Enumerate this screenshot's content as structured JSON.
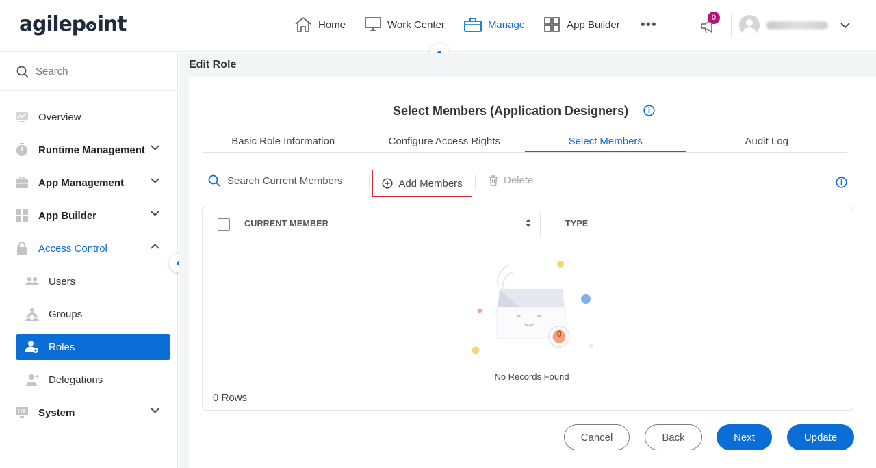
{
  "brand": {
    "logo_text_a": "agile",
    "logo_text_b": "int",
    "logo_letter_p": "p"
  },
  "nav": {
    "items": [
      {
        "label": "Home"
      },
      {
        "label": "Work Center"
      },
      {
        "label": "Manage"
      },
      {
        "label": "App Builder"
      }
    ],
    "more": "•••",
    "notification_count": "0"
  },
  "sidebar": {
    "search_placeholder": "Search",
    "items": [
      {
        "label": "Overview"
      },
      {
        "label": "Runtime Management"
      },
      {
        "label": "App Management"
      },
      {
        "label": "App Builder"
      },
      {
        "label": "Access Control"
      },
      {
        "label": "Users"
      },
      {
        "label": "Groups"
      },
      {
        "label": "Roles"
      },
      {
        "label": "Delegations"
      },
      {
        "label": "System"
      }
    ]
  },
  "page": {
    "title": "Edit Role",
    "card_title": "Select Members (Application Designers)",
    "tabs": [
      {
        "label": "Basic Role Information"
      },
      {
        "label": "Configure Access Rights"
      },
      {
        "label": "Select Members"
      },
      {
        "label": "Audit Log"
      }
    ],
    "toolbar": {
      "search_label": "Search Current Members",
      "add_label": "Add Members",
      "delete_label": "Delete"
    },
    "grid": {
      "columns": [
        "CURRENT MEMBER",
        "TYPE"
      ],
      "empty_badge": "0",
      "empty_text": "No Records Found",
      "row_count": "0 Rows"
    },
    "buttons": {
      "cancel": "Cancel",
      "back": "Back",
      "next": "Next",
      "update": "Update"
    }
  },
  "colors": {
    "accent": "#0b6ed6",
    "highlight_border": "#d52b30",
    "badge": "#b5127a"
  }
}
